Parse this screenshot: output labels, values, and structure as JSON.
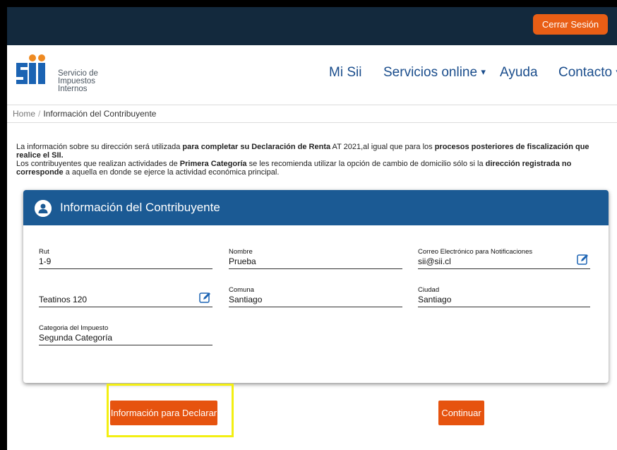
{
  "topbar": {
    "logout_label": "Cerrar Sesión"
  },
  "logo": {
    "line1": "Servicio de",
    "line2": "Impuestos",
    "line3": "Internos",
    "colors": {
      "blue": "#1b63b3",
      "orange": "#ee8a22"
    }
  },
  "nav": {
    "mi_sii": "Mi Sii",
    "servicios": "Servicios online",
    "ayuda": "Ayuda",
    "contacto": "Contacto",
    "caret": "▾"
  },
  "breadcrumb": {
    "home": "Home",
    "separator": "/",
    "current": "Información del Contribuyente"
  },
  "intro": {
    "p1": [
      {
        "t": "La información sobre su dirección será utilizada ",
        "b": false
      },
      {
        "t": "para completar su Declaración de Renta",
        "b": true
      },
      {
        "t": " AT 2021,al igual que para los ",
        "b": false
      },
      {
        "t": "procesos posteriores de fiscalización que realice el SII.",
        "b": true
      }
    ],
    "p2": [
      {
        "t": "Los contribuyentes que realizan actividades de ",
        "b": false
      },
      {
        "t": "Primera Categoría",
        "b": true
      },
      {
        "t": " se les recomienda utilizar la opción de cambio de domicilio sólo si la ",
        "b": false
      },
      {
        "t": "dirección registrada no corresponde",
        "b": true
      },
      {
        "t": " a aquella en donde se ejerce la actividad económica principal.",
        "b": false
      }
    ]
  },
  "card": {
    "title": "Información del Contribuyente",
    "fields": {
      "rut": {
        "label": "Rut",
        "value": "1-9"
      },
      "nombre": {
        "label": "Nombre",
        "value": "Prueba"
      },
      "correo": {
        "label": "Correo Electrónico para Notificaciones",
        "value": "sii@sii.cl"
      },
      "direccion": {
        "label": "",
        "value": "Teatinos 120"
      },
      "comuna": {
        "label": "Comuna",
        "value": "Santiago"
      },
      "ciudad": {
        "label": "Ciudad",
        "value": "Santiago"
      },
      "categoria": {
        "label": "Categoria del Impuesto",
        "value": "Segunda Categoría"
      }
    }
  },
  "actions": {
    "info_declarar": "Información para Declarar",
    "continuar": "Continuar"
  },
  "colors": {
    "topbar": "#13293d",
    "accent_orange": "#e6530f",
    "card_header": "#1b5a94",
    "highlight": "#f3ef12",
    "nav_text": "#1a4d8c"
  }
}
